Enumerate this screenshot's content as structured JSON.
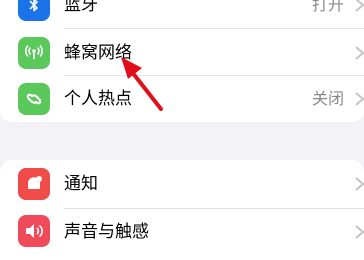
{
  "settings": {
    "network_group": [
      {
        "label": "蓝牙",
        "value": "打开",
        "icon": "bluetooth-icon",
        "color": "#1a73e8"
      },
      {
        "label": "蜂窝网络",
        "value": "",
        "icon": "antenna-icon",
        "color": "#5ac85a"
      },
      {
        "label": "个人热点",
        "value": "关闭",
        "icon": "hotspot-icon",
        "color": "#5ac85a"
      }
    ],
    "notify_group": [
      {
        "label": "通知",
        "value": "",
        "icon": "notification-icon",
        "color": "#ef4b48"
      },
      {
        "label": "声音与触感",
        "value": "",
        "icon": "speaker-icon",
        "color": "#ef4b5b"
      }
    ]
  },
  "annotation": {
    "icon": "red-arrow-icon",
    "color": "#e0101a"
  }
}
